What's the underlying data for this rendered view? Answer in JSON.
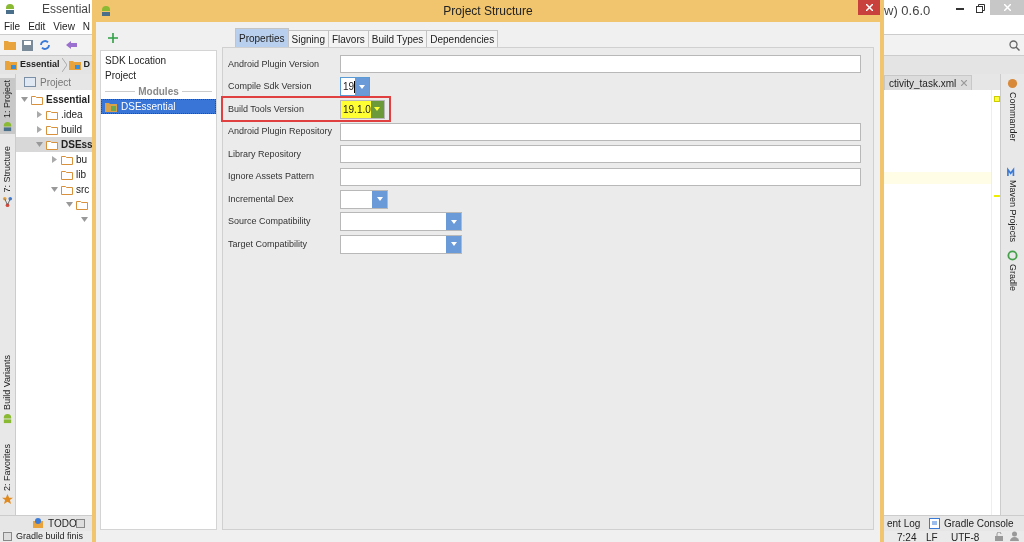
{
  "ide": {
    "title": "Essential",
    "title_right": "w) 0.6.0",
    "menu": [
      "File",
      "Edit",
      "View",
      "N"
    ],
    "breadcrumb": [
      "Essential",
      "D"
    ],
    "left_tool_tabs": [
      {
        "label": "1: Project",
        "selected": true
      },
      {
        "label": "7: Structure",
        "selected": false
      },
      {
        "label": "Build Variants",
        "selected": false
      },
      {
        "label": "2: Favorites",
        "selected": false
      }
    ],
    "project_panel": {
      "title": "Project",
      "tree": [
        {
          "label": "Essential",
          "expanded": true,
          "selected": false,
          "children": [
            {
              "label": ".idea",
              "expanded": false,
              "selected": false
            },
            {
              "label": "build",
              "expanded": false,
              "selected": false
            },
            {
              "label": "DSEss",
              "expanded": true,
              "selected": true,
              "children": [
                {
                  "label": "bu",
                  "expanded": false,
                  "selected": false
                },
                {
                  "label": "lib",
                  "selected": false
                },
                {
                  "label": "src",
                  "expanded": true,
                  "selected": false,
                  "children": [
                    {
                      "expanded": true,
                      "selected": false,
                      "children": [
                        {
                          "expanded": true,
                          "selected": false
                        }
                      ]
                    }
                  ]
                }
              ]
            }
          ]
        }
      ]
    },
    "editor_tab": "ctivity_task.xml",
    "right_tool_tabs": [
      "Commander",
      "Maven Projects",
      "Gradle"
    ],
    "bottom_tabs": [
      "TODO",
      "ent Log",
      "Gradle Console"
    ],
    "status": {
      "message": "Gradle build finis",
      "position": "7:24",
      "line_separator": "LF",
      "encoding": "UTF-8"
    }
  },
  "dialog": {
    "title": "Project Structure",
    "sidebar": {
      "items": [
        {
          "label": "SDK Location",
          "selected": false
        },
        {
          "label": "Project",
          "selected": false
        }
      ],
      "section": "Modules",
      "modules": [
        {
          "label": "DSEssential",
          "selected": true
        }
      ]
    },
    "tabs": [
      {
        "label": "Properties",
        "selected": true
      },
      {
        "label": "Signing",
        "selected": false
      },
      {
        "label": "Flavors",
        "selected": false
      },
      {
        "label": "Build Types",
        "selected": false
      },
      {
        "label": "Dependencies",
        "selected": false
      }
    ],
    "fields": [
      {
        "label": "Android Plugin Version",
        "kind": "text"
      },
      {
        "label": "Compile Sdk Version",
        "kind": "combo",
        "value": "19",
        "focused": true,
        "highlighted": false
      },
      {
        "label": "Build Tools Version",
        "kind": "combo",
        "value": "19.1.0",
        "focused": false,
        "highlighted": true
      },
      {
        "label": "Android Plugin Repository",
        "kind": "text"
      },
      {
        "label": "Library Repository",
        "kind": "text"
      },
      {
        "label": "Ignore Assets Pattern",
        "kind": "text"
      },
      {
        "label": "Incremental Dex",
        "kind": "combo",
        "focused": false,
        "highlighted": false
      },
      {
        "label": "Source Compatibility",
        "kind": "combo",
        "focused": false,
        "highlighted": false
      },
      {
        "label": "Target Compatibility",
        "kind": "combo",
        "focused": false,
        "highlighted": false
      }
    ]
  }
}
